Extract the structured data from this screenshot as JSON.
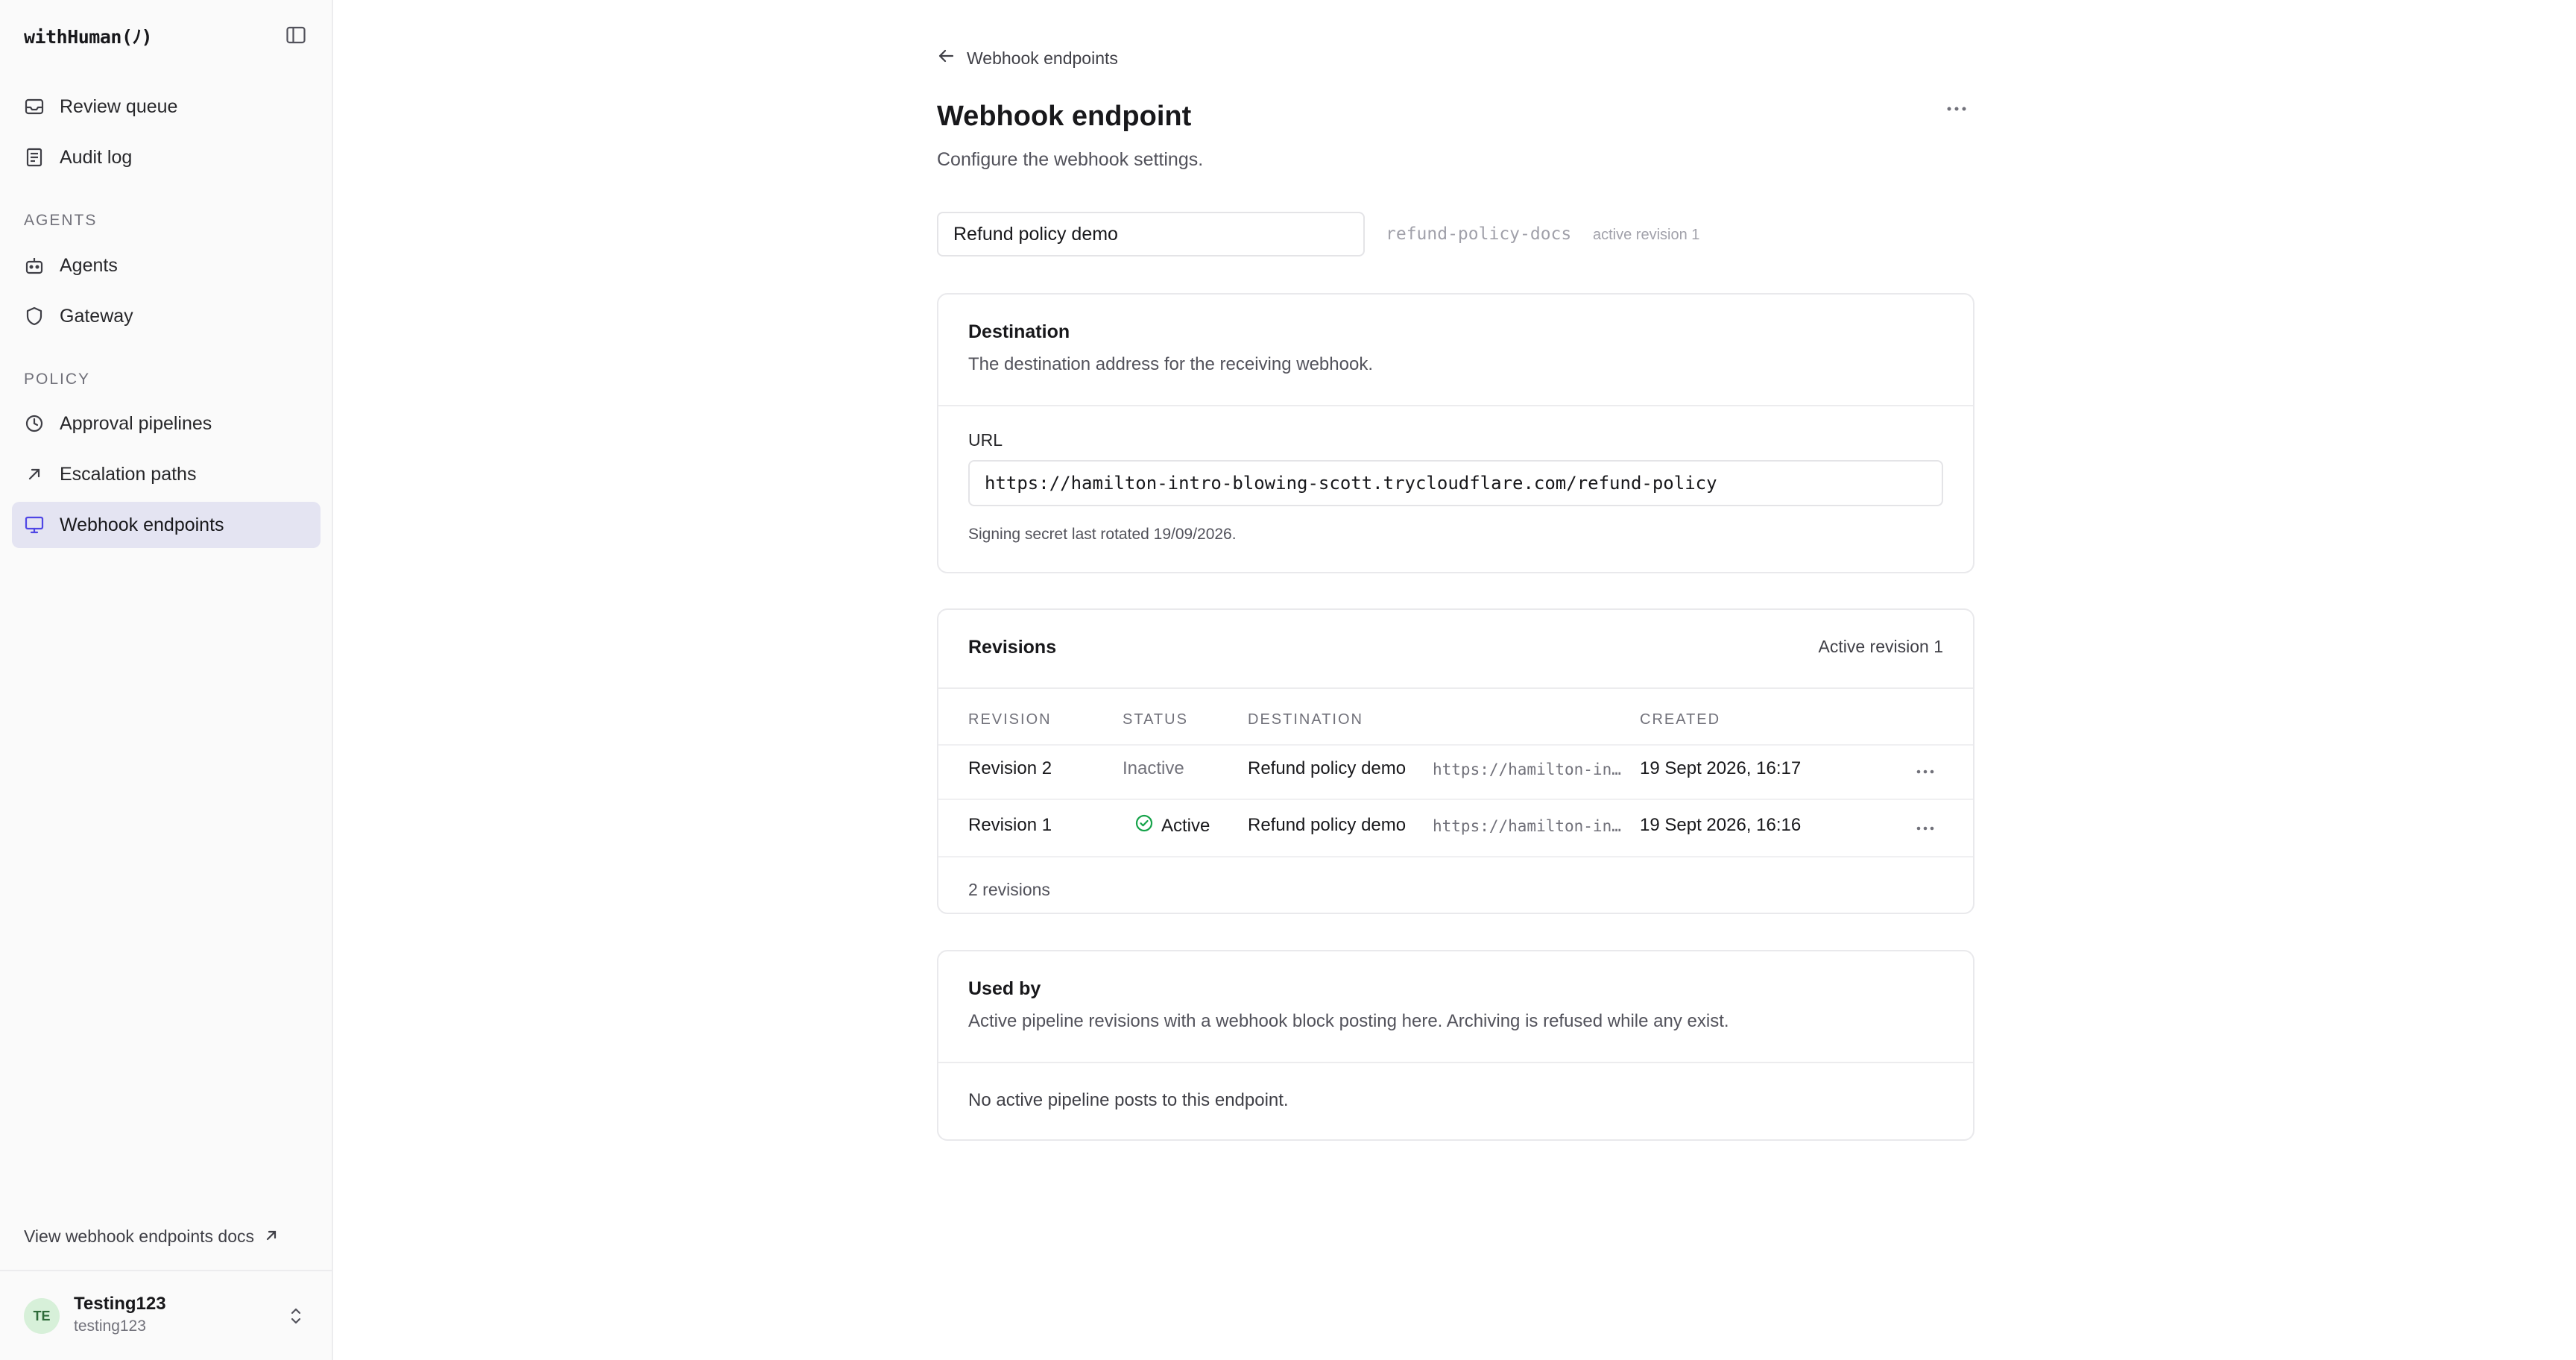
{
  "app": {
    "brand": "withHuman(ﾉ)"
  },
  "sidebar": {
    "top_items": [
      {
        "label": "Review queue",
        "icon": "inbox-icon"
      },
      {
        "label": "Audit log",
        "icon": "document-icon"
      }
    ],
    "agents_section": {
      "label": "AGENTS",
      "items": [
        {
          "label": "Agents",
          "icon": "bot-icon"
        },
        {
          "label": "Gateway",
          "icon": "shield-icon"
        }
      ]
    },
    "policy_section": {
      "label": "POLICY",
      "items": [
        {
          "label": "Approval pipelines",
          "icon": "clock-icon"
        },
        {
          "label": "Escalation paths",
          "icon": "arrow-up-right-icon"
        },
        {
          "label": "Webhook endpoints",
          "icon": "monitor-icon",
          "active": true
        }
      ]
    },
    "docs_link": "View webhook endpoints docs",
    "user": {
      "initials": "TE",
      "name": "Testing123",
      "handle": "testing123"
    }
  },
  "header": {
    "back_label": "Webhook endpoints",
    "title": "Webhook endpoint",
    "subtitle": "Configure the webhook settings."
  },
  "endpoint": {
    "name_value": "Refund policy demo",
    "slug": "refund-policy-docs",
    "active_revision_tag": "active revision 1"
  },
  "destination": {
    "title": "Destination",
    "description": "The destination address for the receiving webhook.",
    "url_label": "URL",
    "url_value": "https://hamilton-intro-blowing-scott.trycloudflare.com/refund-policy",
    "hint": "Signing secret last rotated 19/09/2026."
  },
  "revisions": {
    "title": "Revisions",
    "active_label": "Active revision 1",
    "columns": [
      "REVISION",
      "STATUS",
      "DESTINATION",
      "CREATED"
    ],
    "rows": [
      {
        "revision": "Revision 2",
        "status": "Inactive",
        "dest_name": "Refund policy demo",
        "dest_url": "https://hamilton-intro-blowing-scott.trycloudflare.com/refund-policy",
        "created": "19 Sept 2026, 16:17"
      },
      {
        "revision": "Revision 1",
        "status": "Active",
        "dest_name": "Refund policy demo",
        "dest_url": "https://hamilton-intro-blowing-scott.trycloudflare.com/refund-policy",
        "created": "19 Sept 2026, 16:16"
      }
    ],
    "count": "2 revisions"
  },
  "used_by": {
    "title": "Used by",
    "description": "Active pipeline revisions with a webhook block posting here. Archiving is refused while any exist.",
    "empty": "No active pipeline posts to this endpoint."
  },
  "colors": {
    "accent": "#4f46e5",
    "active_nav_bg": "#e4e4f2",
    "success": "#16a34a"
  }
}
